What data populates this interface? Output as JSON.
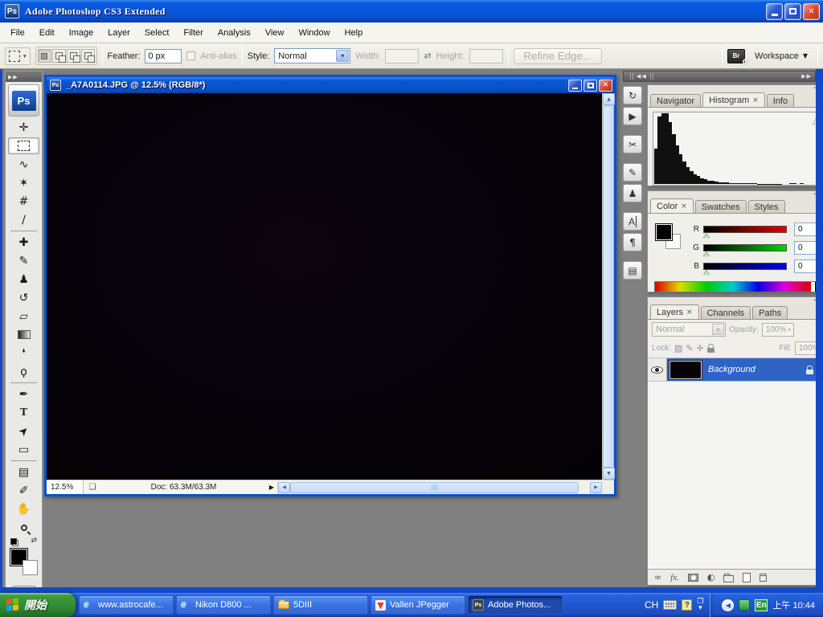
{
  "app": {
    "title": "Adobe Photoshop CS3 Extended",
    "logo": "Ps"
  },
  "menu_bar": {
    "items": [
      "File",
      "Edit",
      "Image",
      "Layer",
      "Select",
      "Filter",
      "Analysis",
      "View",
      "Window",
      "Help"
    ]
  },
  "options_bar": {
    "feather_label": "Feather:",
    "feather_value": "0 px",
    "anti_alias_label": "Anti-alias",
    "style_label": "Style:",
    "style_value": "Normal",
    "width_label": "Width:",
    "height_label": "Height:",
    "refine_edge_label": "Refine Edge...",
    "bridge_label": "Br",
    "workspace_label": "Workspace"
  },
  "toolbox": {
    "logo": "Ps",
    "tools": [
      {
        "name": "move",
        "glyph": "✛"
      },
      {
        "name": "rectangular-marquee",
        "glyph": "",
        "selected": true
      },
      {
        "name": "lasso",
        "glyph": "∿"
      },
      {
        "name": "quick-selection",
        "glyph": "✶"
      },
      {
        "name": "crop",
        "glyph": "#"
      },
      {
        "name": "slice",
        "glyph": "∕"
      },
      {
        "name": "spot-healing-brush",
        "glyph": "✚"
      },
      {
        "name": "brush",
        "glyph": "✎"
      },
      {
        "name": "clone-stamp",
        "glyph": "♟"
      },
      {
        "name": "history-brush",
        "glyph": "↺"
      },
      {
        "name": "eraser",
        "glyph": "▱"
      },
      {
        "name": "gradient",
        "glyph": ""
      },
      {
        "name": "blur",
        "glyph": "❛"
      },
      {
        "name": "burn",
        "glyph": "ϙ"
      },
      {
        "name": "pen",
        "glyph": "✒"
      },
      {
        "name": "type",
        "glyph": "T"
      },
      {
        "name": "path-selection",
        "glyph": "➤"
      },
      {
        "name": "rectangle",
        "glyph": "▭"
      },
      {
        "name": "notes",
        "glyph": "▤"
      },
      {
        "name": "eyedropper",
        "glyph": "✐"
      },
      {
        "name": "hand",
        "glyph": "✋"
      },
      {
        "name": "zoom",
        "glyph": ""
      }
    ]
  },
  "document_window": {
    "icon": "Ps",
    "title": "_A7A0114.JPG @ 12.5% (RGB/8*)",
    "status": {
      "zoom": "12.5%",
      "doc_info": "Doc: 63.3M/63.3M"
    }
  },
  "dock": {
    "icons": [
      {
        "name": "history",
        "glyph": "↻"
      },
      {
        "name": "actions",
        "glyph": "▶"
      },
      {
        "name": "tool-presets",
        "glyph": "✂"
      },
      {
        "name": "brushes",
        "glyph": "✎"
      },
      {
        "name": "clone-source",
        "glyph": "♟"
      },
      {
        "name": "character",
        "glyph": "A"
      },
      {
        "name": "paragraph",
        "glyph": "¶"
      },
      {
        "name": "layer-comps",
        "glyph": "▤"
      }
    ]
  },
  "panels": {
    "navigator_group": {
      "tabs": [
        {
          "label": "Navigator"
        },
        {
          "label": "Histogram",
          "active": true
        },
        {
          "label": "Info"
        }
      ],
      "histogram": {
        "values": [
          0.5,
          0.95,
          1,
          1,
          0.88,
          0.7,
          0.55,
          0.42,
          0.32,
          0.24,
          0.18,
          0.14,
          0.11,
          0.085,
          0.065,
          0.05,
          0.04,
          0.034,
          0.028,
          0.024,
          0.02,
          0.017,
          0.014,
          0.012,
          0.01,
          0.009,
          0.008,
          0.007,
          0.006,
          0.005,
          0.004,
          0.004,
          0.003,
          0.003,
          0.002,
          0.002,
          0,
          0,
          0.012,
          0.012,
          0,
          0.012,
          0,
          0,
          0,
          0,
          0,
          0
        ]
      }
    },
    "color_group": {
      "tabs": [
        {
          "label": "Color",
          "active": true
        },
        {
          "label": "Swatches"
        },
        {
          "label": "Styles"
        }
      ],
      "channels": [
        {
          "label": "R",
          "value": "0"
        },
        {
          "label": "G",
          "value": "0"
        },
        {
          "label": "B",
          "value": "0"
        }
      ]
    },
    "layers_group": {
      "tabs": [
        {
          "label": "Layers",
          "active": true
        },
        {
          "label": "Channels"
        },
        {
          "label": "Paths"
        }
      ],
      "blend_mode": "Normal",
      "opacity_label": "Opacity:",
      "opacity_value": "100%",
      "lock_label": "Lock:",
      "fill_label": "Fill:",
      "fill_value": "100%",
      "fx_label": "fx.",
      "layers": [
        {
          "name": "Background",
          "locked": true,
          "visible": true
        }
      ]
    }
  },
  "taskbar": {
    "start_label": "開始",
    "tasks": [
      {
        "label": "www.astrocafe...",
        "icon": "ie"
      },
      {
        "label": "Nikon D800 ...",
        "icon": "ie"
      },
      {
        "label": "5DIII",
        "icon": "folder"
      },
      {
        "label": "Vallen JPegger",
        "icon": "vallen"
      },
      {
        "label": "Adobe Photos...",
        "icon": "photoshop",
        "active": true
      }
    ],
    "language_indicator": "CH",
    "tray": {
      "lang_badge": "En",
      "time": "上午 10:44"
    }
  },
  "ui": {
    "minimize": "−",
    "close_x": "×",
    "win_close": "✕",
    "panel_menu": "▾≡",
    "tab_close": "×",
    "collapse_left": "◀◀",
    "collapse_right": "▶▶",
    "dropdown_caret": "▾",
    "workspace_caret": "▼",
    "swap_dims": "⇄",
    "status_menu": "▶",
    "page_icon": "❏",
    "warning": "⚠",
    "spinner": "▸",
    "scroll_up": "▲",
    "scroll_down": "▼",
    "scroll_left": "◀",
    "scroll_right": "▶",
    "link": "∞",
    "adjustment": "◐",
    "vallen_glyph": "▼",
    "ie_glyph": "e",
    "transparency_lock": "▨",
    "paint_lock": "✎",
    "move_lock": "✛"
  },
  "colors": {
    "titlebar_blue": "#0855D4",
    "selection_blue": "#2F63C6",
    "workspace_gray": "#808080",
    "taskbar_blue": "#2157CE",
    "start_green": "#2F8A33",
    "close_red": "#C03A20"
  }
}
